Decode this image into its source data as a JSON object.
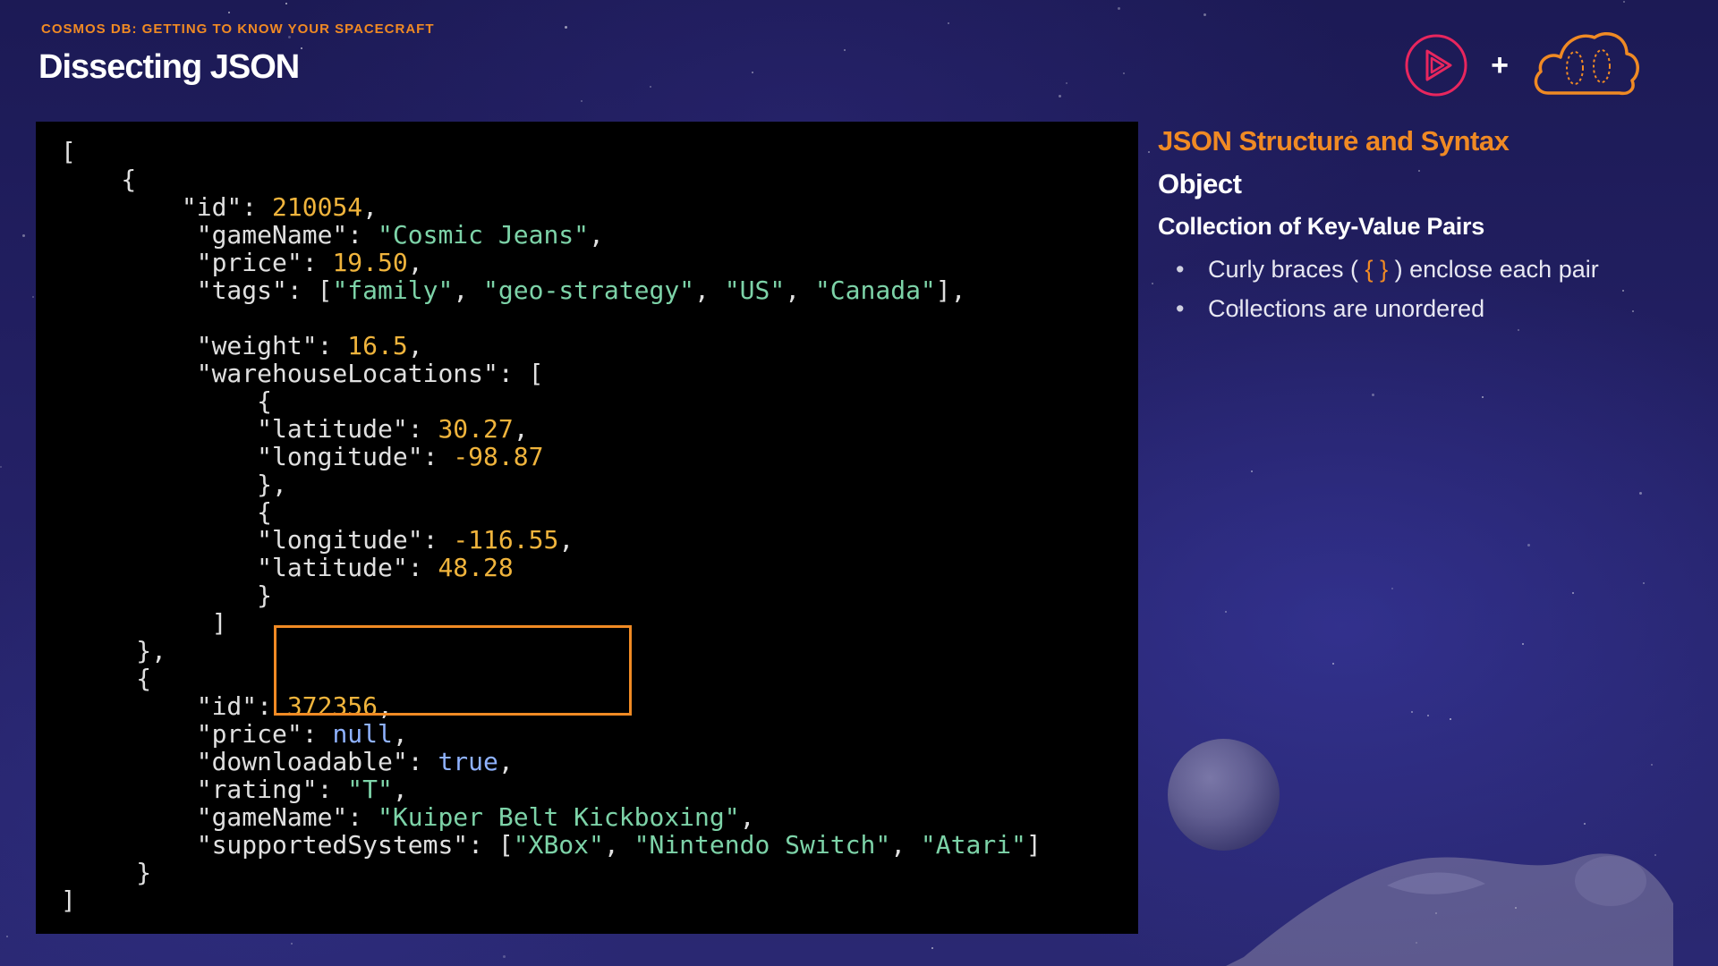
{
  "header": {
    "eyebrow": "COSMOS DB: GETTING TO KNOW YOUR SPACECRAFT",
    "title": "Dissecting JSON",
    "plus": "+"
  },
  "logos": {
    "left": "play-logo-icon",
    "right": "cloud-logo-icon"
  },
  "colors": {
    "accent": "#f08a24",
    "code_bg": "#000000",
    "string": "#7dd3a8",
    "number": "#f0b43c",
    "literal": "#8fb2ff"
  },
  "code": {
    "lines": [
      "[",
      "    {",
      "        \"id\": 210054,",
      "         \"gameName\": \"Cosmic Jeans\",",
      "         \"price\": 19.50,",
      "         \"tags\": [\"family\", \"geo-strategy\", \"US\", \"Canada\"],",
      "",
      "         \"weight\": 16.5,",
      "         \"warehouseLocations\": [",
      "             {",
      "             \"latitude\": 30.27,",
      "             \"longitude\": -98.87",
      "             },",
      "             {",
      "             \"longitude\": -116.55,",
      "             \"latitude\": 48.28",
      "             }",
      "          ]",
      "     },",
      "     {",
      "         \"id\": 372356,",
      "         \"price\": null,",
      "         \"downloadable\": true,",
      "         \"rating\": \"T\",",
      "         \"gameName\": \"Kuiper Belt Kickboxing\",",
      "         \"supportedSystems\": [\"XBox\", \"Nintendo Switch\", \"Atari\"]",
      "     }",
      "]"
    ]
  },
  "side": {
    "heading": "JSON Structure and Syntax",
    "subheading": "Object",
    "section": "Collection of Key-Value Pairs",
    "bullets": [
      {
        "before": "Curly braces ( ",
        "accent": "{  }",
        "after": " ) enclose each pair"
      },
      {
        "text": "Collections are unordered"
      }
    ]
  }
}
